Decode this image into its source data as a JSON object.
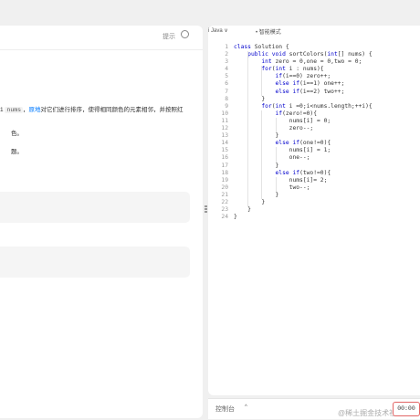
{
  "problem_panel": {
    "hint_label": "提示",
    "description_lines": [
      [
        "",
        {
          "code": "nums"
        },
        "，",
        {
          "link": "原地"
        },
        "对它们进行排序，使得相同颜色的元素相邻，并按照红"
      ],
      [
        "色。"
      ],
      [
        "题。"
      ]
    ]
  },
  "editor": {
    "language": "Java",
    "smart_mode_label": "智能模式",
    "line_numbers": [
      "1",
      "2",
      "3",
      "4",
      "5",
      "6",
      "7",
      "8",
      "9",
      "10",
      "11",
      "12",
      "13",
      "14",
      "15",
      "16",
      "17",
      "18",
      "19",
      "20",
      "21",
      "22",
      "23",
      "24"
    ],
    "code_lines": [
      "class Solution {",
      "    public void sortColors(int[] nums) {",
      "        int zero = 0,one = 0,two = 0;",
      "        for(int i : nums){",
      "            if(i==0) zero++;",
      "            else if(i==1) one++;",
      "            else if(i==2) two++;",
      "        }",
      "        for(int i =0;i<nums.length;++i){",
      "            if(zero!=0){",
      "                nums[i] = 0;",
      "                zero--;",
      "            }",
      "            else if(one!=0){",
      "                nums[i] = 1;",
      "                one--;",
      "            }",
      "            else if(two!=0){",
      "                nums[i]= 2;",
      "                two--;",
      "            }",
      "        }",
      "    }",
      "}"
    ]
  },
  "bottom_bar": {
    "console_label": "控制台",
    "timer": "00:00",
    "watermark": "@稀土掘金技术社区"
  }
}
